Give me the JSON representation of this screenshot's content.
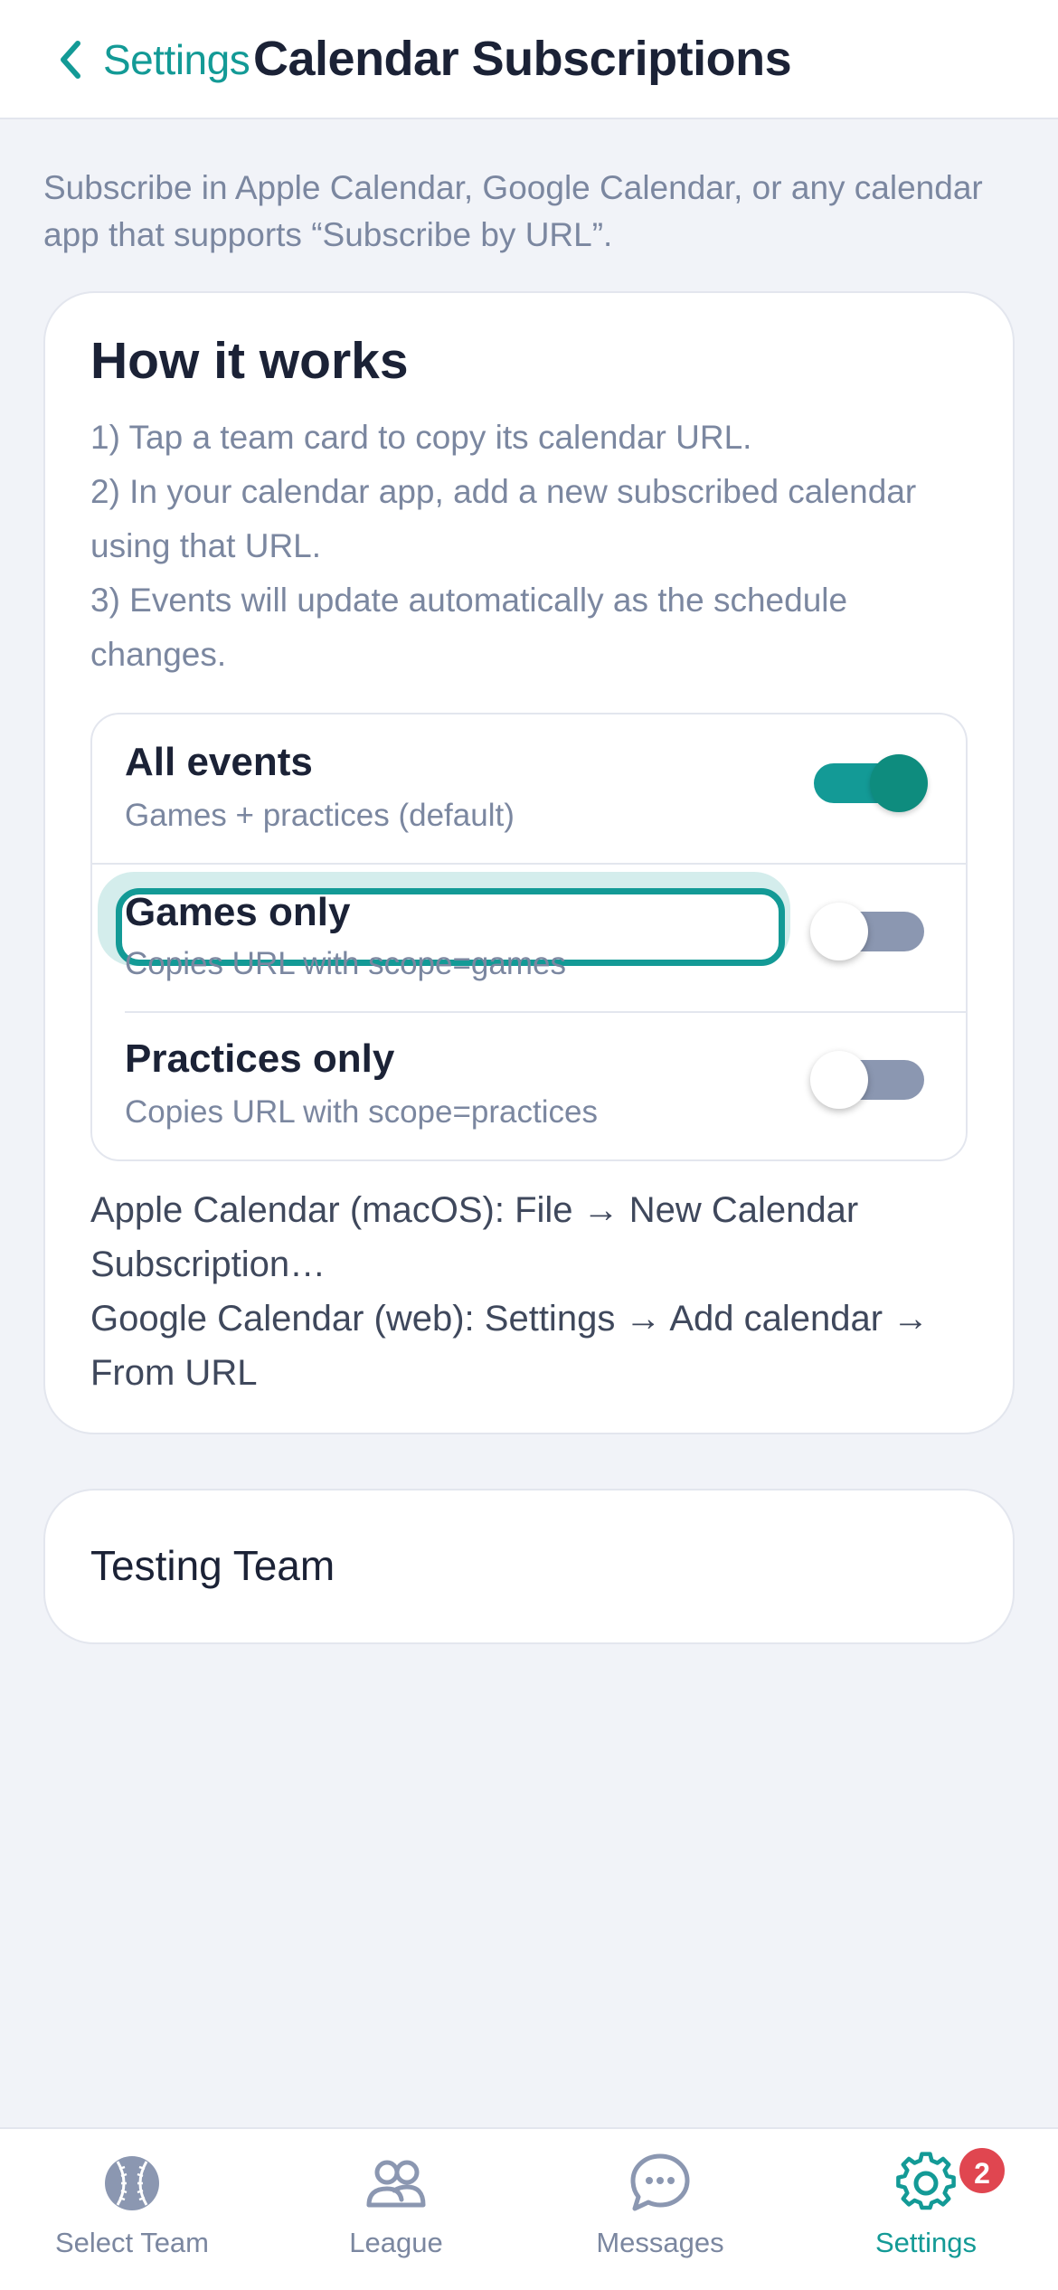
{
  "header": {
    "back_label": "Settings",
    "title": "Calendar Subscriptions"
  },
  "intro": "Subscribe in Apple Calendar, Google Calendar, or any calendar app that supports “Subscribe by URL”.",
  "how_it_works": {
    "title": "How it works",
    "steps": [
      "1) Tap a team card to copy its calendar URL.",
      "2) In your calendar app, add a new subscribed calendar using that URL.",
      "3) Events will update automatically as the schedule changes."
    ],
    "options": [
      {
        "title": "All events",
        "subtitle": "Games + practices (default)",
        "enabled": true
      },
      {
        "title": "Games only",
        "subtitle": "Copies URL with scope=games",
        "enabled": false
      },
      {
        "title": "Practices only",
        "subtitle": "Copies URL with scope=practices",
        "enabled": false
      }
    ],
    "notes": [
      "Apple Calendar (macOS): File → New Calendar Subscription…",
      "Google Calendar (web): Settings → Add calendar → From URL"
    ]
  },
  "teams": [
    {
      "name": "Testing Team"
    }
  ],
  "tabbar": {
    "tabs": [
      {
        "label": "Select Team",
        "icon": "baseball-icon"
      },
      {
        "label": "League",
        "icon": "users-icon"
      },
      {
        "label": "Messages",
        "icon": "chat-icon"
      },
      {
        "label": "Settings",
        "icon": "gear-icon",
        "badge": "2",
        "active": true
      }
    ]
  },
  "colors": {
    "accent": "#139a96",
    "badge": "#e04650",
    "toggle_off": "#8b97b1"
  }
}
